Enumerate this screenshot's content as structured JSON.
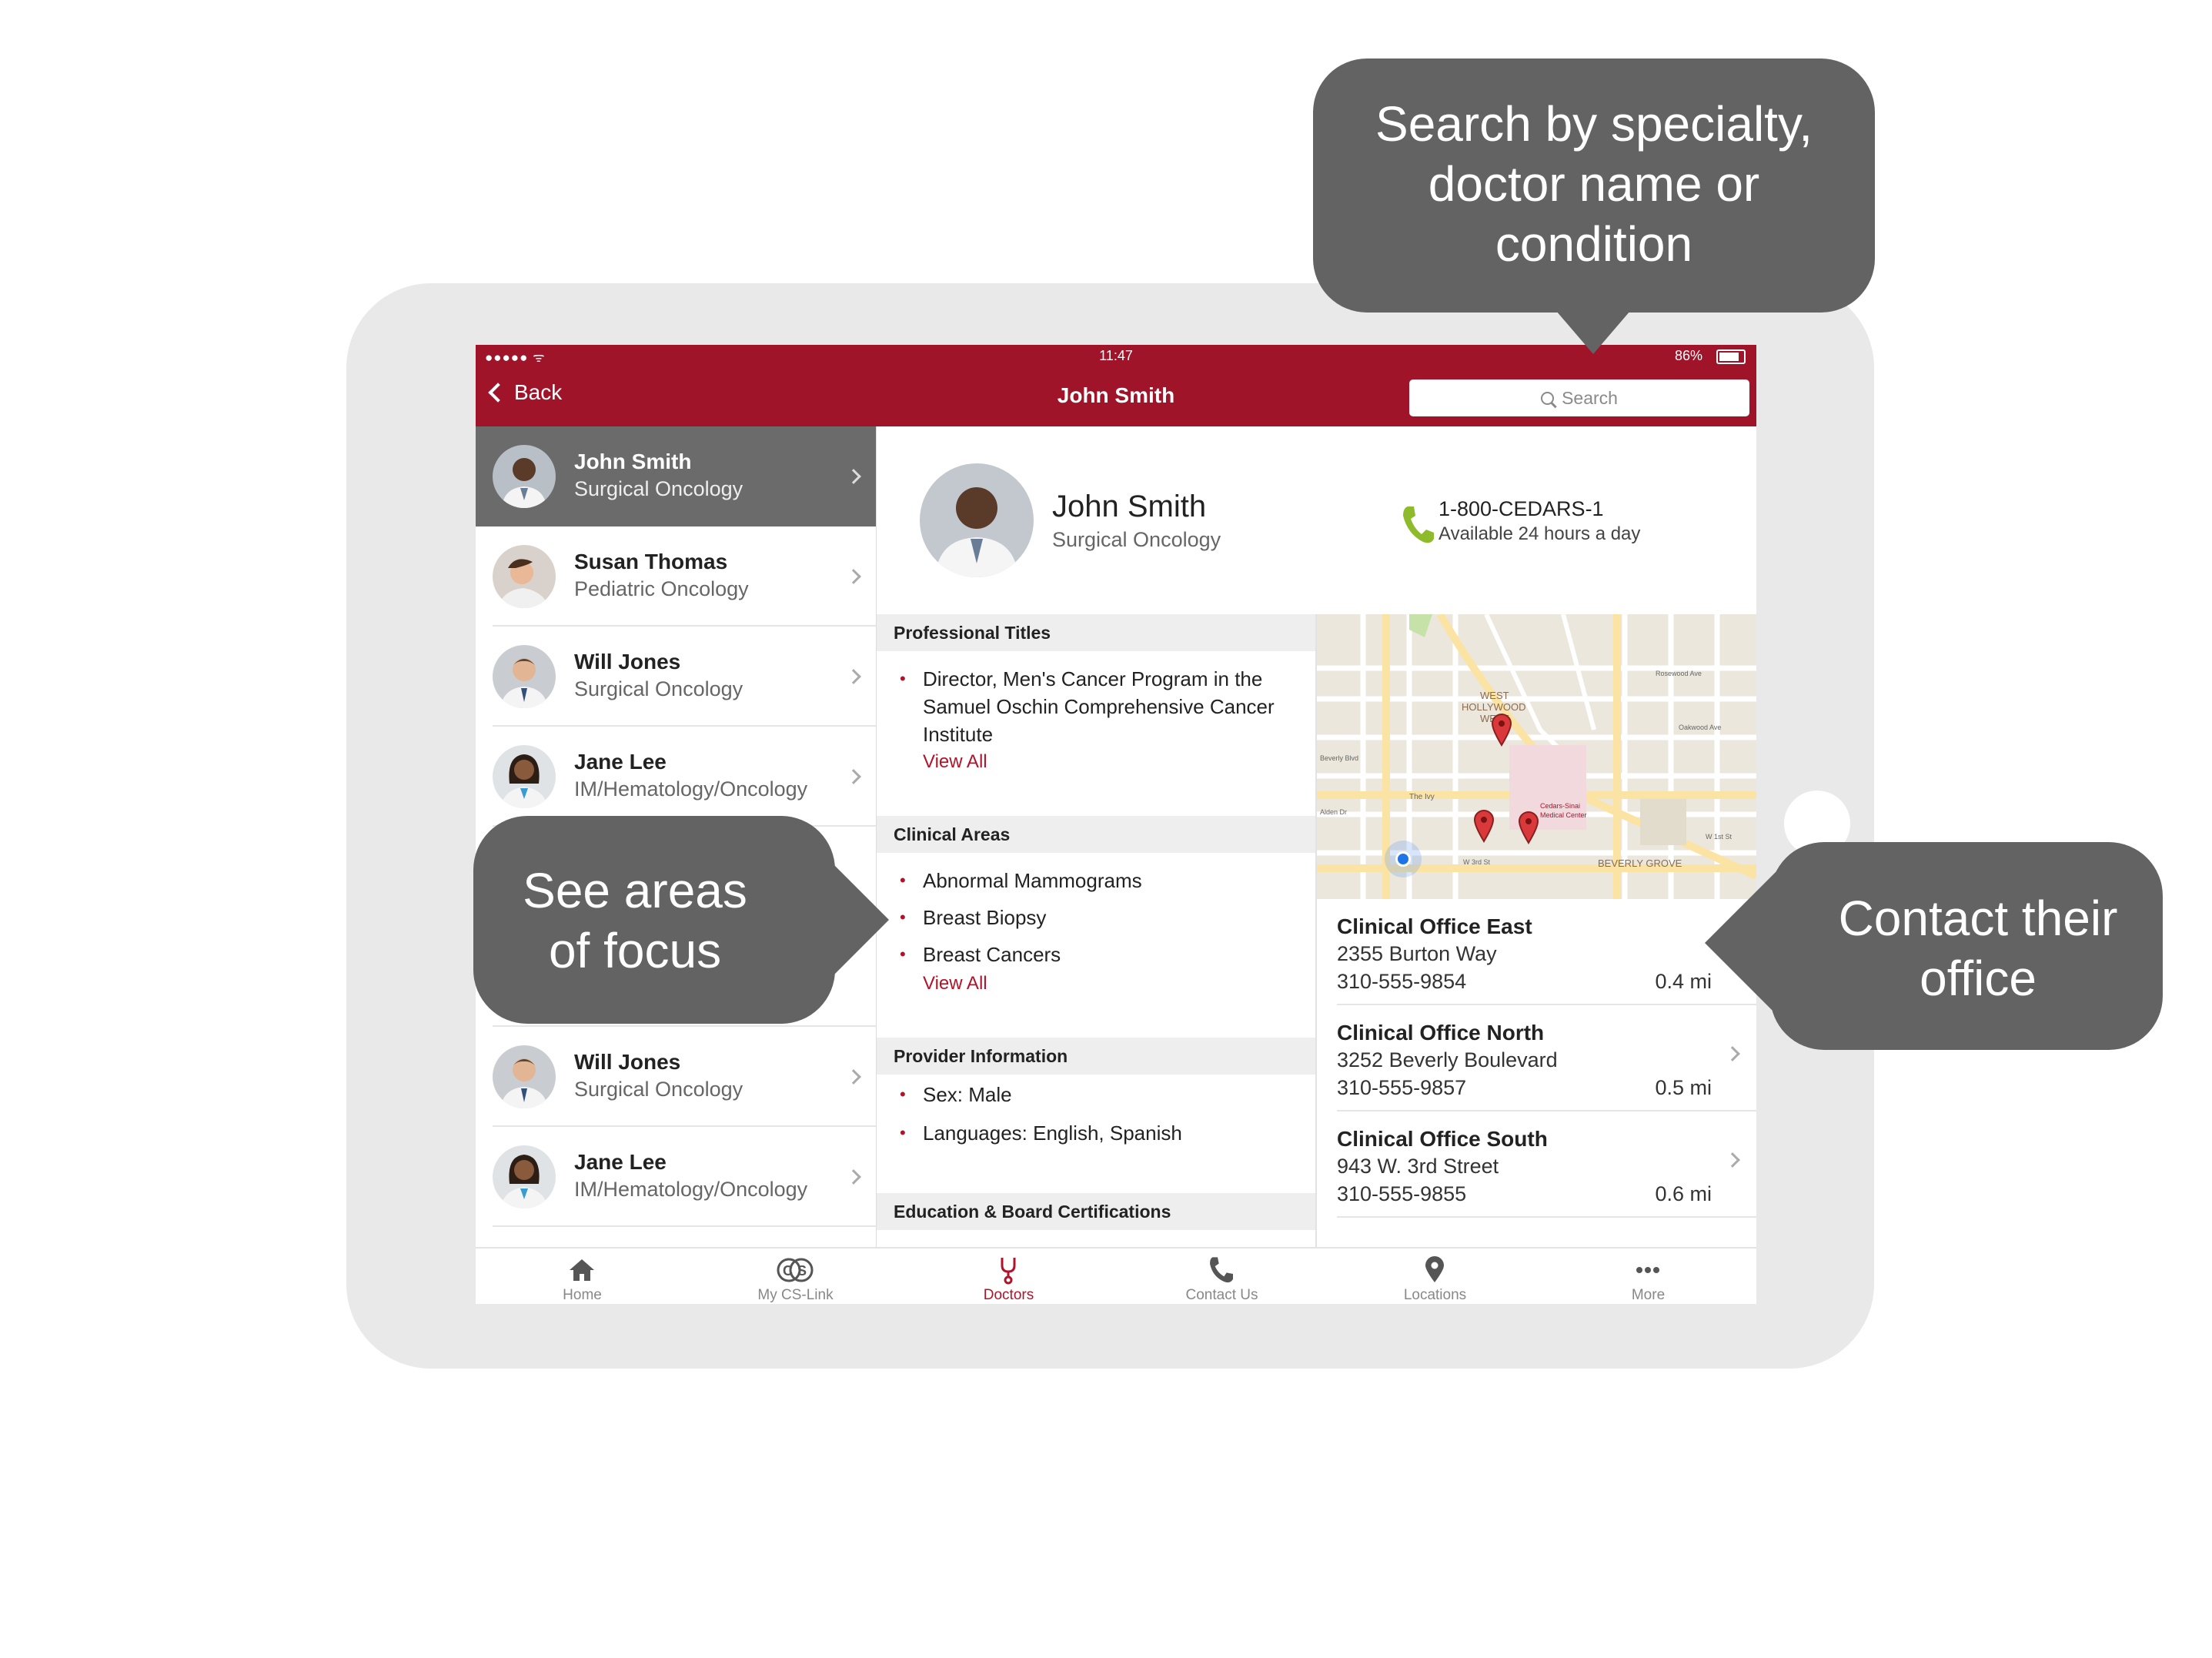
{
  "status_bar": {
    "signal": "●●●●● ᯤ",
    "time": "11:47",
    "battery": "86%"
  },
  "nav": {
    "back_label": "Back",
    "title": "John Smith",
    "search_placeholder": "Search"
  },
  "doctors": [
    {
      "name": "John Smith",
      "specialty": "Surgical Oncology",
      "selected": true
    },
    {
      "name": "Susan Thomas",
      "specialty": "Pediatric Oncology"
    },
    {
      "name": "Will Jones",
      "specialty": "Surgical Oncology"
    },
    {
      "name": "Jane Lee",
      "specialty": "IM/Hematology/Oncology"
    },
    {
      "name": "Will Jones",
      "specialty": "Surgical Oncology"
    },
    {
      "name": "Jane Lee",
      "specialty": "IM/Hematology/Oncology"
    }
  ],
  "profile": {
    "name": "John Smith",
    "specialty": "Surgical Oncology",
    "phone": "1-800-CEDARS-1",
    "availability": "Available 24 hours a day"
  },
  "sections": {
    "professional_titles": {
      "header": "Professional Titles",
      "items": [
        "Director, Men's Cancer Program in the Samuel Oschin Comprehensive Cancer Institute"
      ],
      "view_all": "View All"
    },
    "clinical_areas": {
      "header": "Clinical Areas",
      "items": [
        "Abnormal Mammograms",
        "Breast Biopsy",
        "Breast Cancers"
      ],
      "view_all": "View All"
    },
    "provider_info": {
      "header": "Provider Information",
      "items": [
        "Sex: Male",
        "Languages: English, Spanish"
      ]
    },
    "education": {
      "header": "Education & Board Certifications"
    }
  },
  "map": {
    "labels": [
      "WEST",
      "HOLLYWOOD",
      "WEST",
      "BEVERLY GROVE",
      "The Ivy",
      "Cedars-Sinai",
      "Medical Center",
      "W 3rd St",
      "Beverly Blvd",
      "Rosewood Ave",
      "Oakwood Ave",
      "W 1st St",
      "Alden Dr"
    ]
  },
  "offices": [
    {
      "name": "Clinical Office East",
      "address": "2355 Burton Way",
      "phone": "310-555-9854",
      "distance": "0.4 mi"
    },
    {
      "name": "Clinical Office North",
      "address": "3252 Beverly Boulevard",
      "phone": "310-555-9857",
      "distance": "0.5 mi"
    },
    {
      "name": "Clinical Office South",
      "address": "943 W. 3rd Street",
      "phone": "310-555-9855",
      "distance": "0.6 mi"
    }
  ],
  "tabs": [
    {
      "label": "Home",
      "icon": "home-icon"
    },
    {
      "label": "My CS-Link",
      "icon": "cs-link-icon"
    },
    {
      "label": "Doctors",
      "icon": "stethoscope-icon",
      "active": true
    },
    {
      "label": "Contact Us",
      "icon": "phone-icon"
    },
    {
      "label": "Locations",
      "icon": "location-pin-icon"
    },
    {
      "label": "More",
      "icon": "more-icon"
    }
  ],
  "callouts": {
    "search": [
      "Search by specialty,",
      "doctor name or",
      "condition"
    ],
    "focus": [
      "See areas",
      "of focus"
    ],
    "contact": [
      "Contact their",
      "office"
    ]
  },
  "colors": {
    "brand": "#a0142a",
    "accent": "#b0142a",
    "callout": "#636363",
    "phone_green": "#8dbb2b"
  }
}
